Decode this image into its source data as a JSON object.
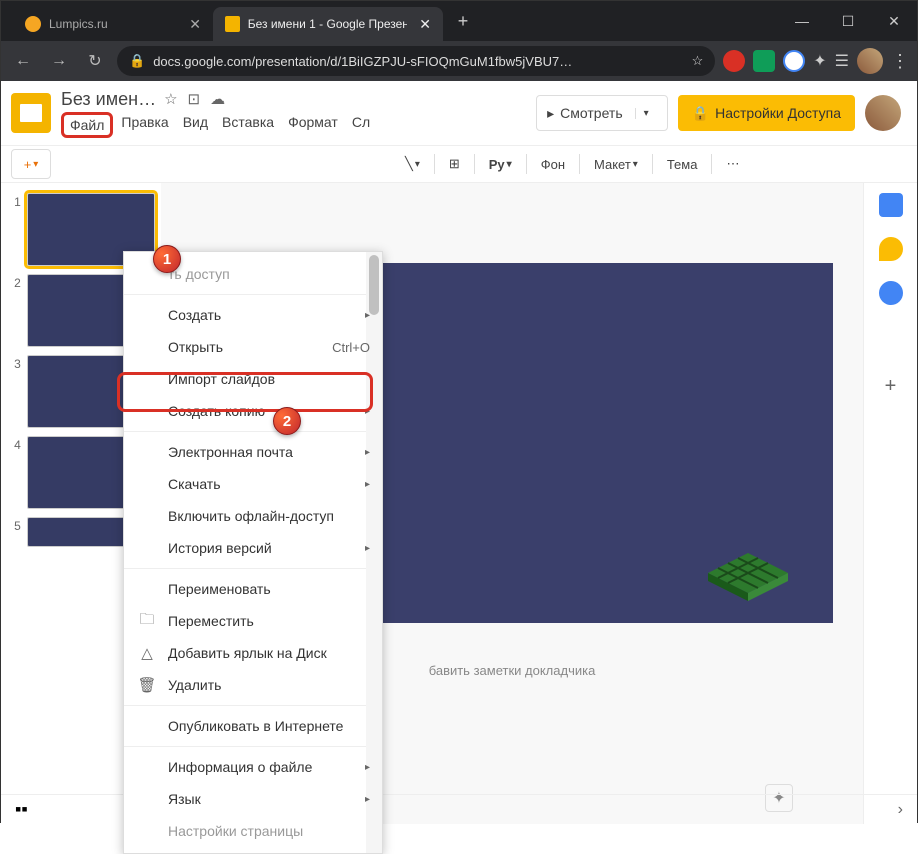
{
  "browser": {
    "tabs": [
      {
        "title": "Lumpics.ru",
        "active": false
      },
      {
        "title": "Без имени 1 - Google Презента",
        "active": true
      }
    ],
    "url": "docs.google.com/presentation/d/1BiIGZPJU-sFIOQmGuM1fbw5jVBU7…"
  },
  "doc": {
    "title": "Без имен…",
    "menus": [
      "Файл",
      "Правка",
      "Вид",
      "Вставка",
      "Формат",
      "Сл"
    ],
    "present": "Смотреть",
    "share": "Настройки Доступа"
  },
  "toolbar": {
    "bg": "Фон",
    "layout": "Макет",
    "theme": "Тема",
    "text": "Py"
  },
  "dropdown": {
    "share": "ть доступ",
    "new": "Создать",
    "open": "Открыть",
    "open_short": "Ctrl+O",
    "import": "Импорт слайдов",
    "copy": "Создать копию",
    "email": "Электронная почта",
    "download": "Скачать",
    "offline": "Включить офлайн-доступ",
    "versions": "История версий",
    "rename": "Переименовать",
    "move": "Переместить",
    "shortcut": "Добавить ярлык на Диск",
    "delete": "Удалить",
    "publish": "Опубликовать в Интернете",
    "info": "Информация о файле",
    "lang": "Язык",
    "page": "Настройки страницы"
  },
  "notes": "бавить заметки докладчика",
  "markers": {
    "m1": "1",
    "m2": "2"
  },
  "thumbs": [
    "1",
    "2",
    "3",
    "4",
    "5"
  ]
}
